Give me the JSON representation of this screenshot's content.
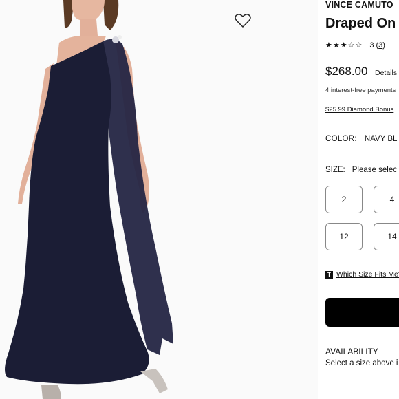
{
  "product": {
    "brand": "VINCE CAMUTO",
    "title": "Draped On",
    "rating_stars": "★★★☆☆",
    "review_count": "3",
    "price": "$268.00",
    "details_link": "Details",
    "installment_text": "4 interest-free payments",
    "bonus_text": "$25.99 Diamond Bonus",
    "color_label": "COLOR:",
    "color_value": "NAVY BL",
    "size_label": "SIZE:",
    "size_prompt": "Please selec",
    "sizes": [
      "2",
      "4",
      "12",
      "14"
    ],
    "fit_badge": "T",
    "fit_link": "Which Size Fits Me?",
    "add_to_bag_label": "",
    "availability_label": "AVAILABILITY",
    "availability_text": "Select a size above i"
  },
  "icons": {
    "wishlist": "heart-outline-icon",
    "fit": "t-badge-icon"
  },
  "colors": {
    "dress_navy": "#1b1d35",
    "button_black": "#000000",
    "text": "#111111"
  }
}
